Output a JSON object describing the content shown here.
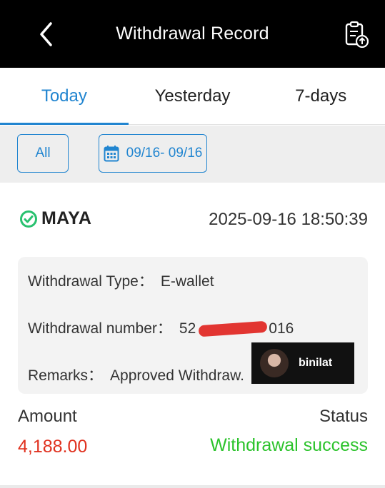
{
  "header": {
    "title": "Withdrawal Record",
    "back_icon": "chevron-left-icon",
    "record_icon": "clipboard-upload-icon"
  },
  "tabs": [
    {
      "label": "Today",
      "active": true
    },
    {
      "label": "Yesterday",
      "active": false
    },
    {
      "label": "7-days",
      "active": false
    }
  ],
  "filters": {
    "all_label": "All",
    "date_range": "09/16- 09/16",
    "calendar_icon": "calendar-icon"
  },
  "record": {
    "brand": "MAYA",
    "datetime": "2025-09-16 18:50:39",
    "type_label": "Withdrawal Type：",
    "type_value": "E-wallet",
    "number_label": "Withdrawal number：",
    "number_prefix": "52",
    "number_suffix": "016",
    "remarks_label": "Remarks：",
    "remarks_value": "Approved Withdraw.",
    "amount_label": "Amount",
    "amount_value": "4,188.00",
    "status_label": "Status",
    "status_value": "Withdrawal success"
  },
  "overlay_tag": {
    "text": "binilat"
  },
  "colors": {
    "accent": "#2185d0",
    "amount": "#e0311f",
    "success": "#2cc32c",
    "header_bg": "#000000",
    "filter_bg": "#eeeeee"
  }
}
